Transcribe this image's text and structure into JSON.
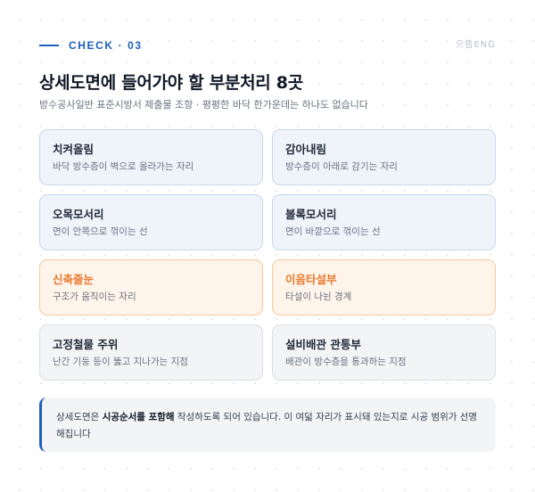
{
  "header": {
    "check_label": "CHECK · 03",
    "brand": "으뜸ENG"
  },
  "title": "상세도면에 들어가야 할 부분처리 8곳",
  "subtitle": "방수공사일반 표준시방서 제출물 조항 · 평평한 바닥 한가운데는 하나도 없습니다",
  "cards": [
    {
      "title": "치켜올림",
      "desc": "바닥 방수층이 벽으로 올라가는 자리",
      "tone": "blue"
    },
    {
      "title": "감아내림",
      "desc": "방수층이 아래로 감기는 자리",
      "tone": "blue"
    },
    {
      "title": "오목모서리",
      "desc": "면이 안쪽으로 꺾이는 선",
      "tone": "blue"
    },
    {
      "title": "볼록모서리",
      "desc": "면이 바깥으로 꺾이는 선",
      "tone": "blue"
    },
    {
      "title": "신축줄눈",
      "desc": "구조가 움직이는 자리",
      "tone": "orange"
    },
    {
      "title": "이음타설부",
      "desc": "타설이 나뉜 경계",
      "tone": "orange"
    },
    {
      "title": "고정철물 주위",
      "desc": "난간 기둥 등이 뚫고 지나가는 지점",
      "tone": "gray"
    },
    {
      "title": "설비배관 관통부",
      "desc": "배관이 방수층을 통과하는 지점",
      "tone": "gray"
    }
  ],
  "note": {
    "prefix": "상세도면은 ",
    "bold": "시공순서를 포함해",
    "suffix": " 작성하도록 되어 있습니다. 이 여덟 자리가 표시돼 있는지로 시공 범위가 선명해집니다"
  },
  "colors": {
    "accent": "#1d5fbf",
    "blue_card_bg": "#eff4fb",
    "orange_title": "#e8792e",
    "orange_card_bg": "#fef4ea",
    "gray_card_bg": "#f3f4f6"
  }
}
